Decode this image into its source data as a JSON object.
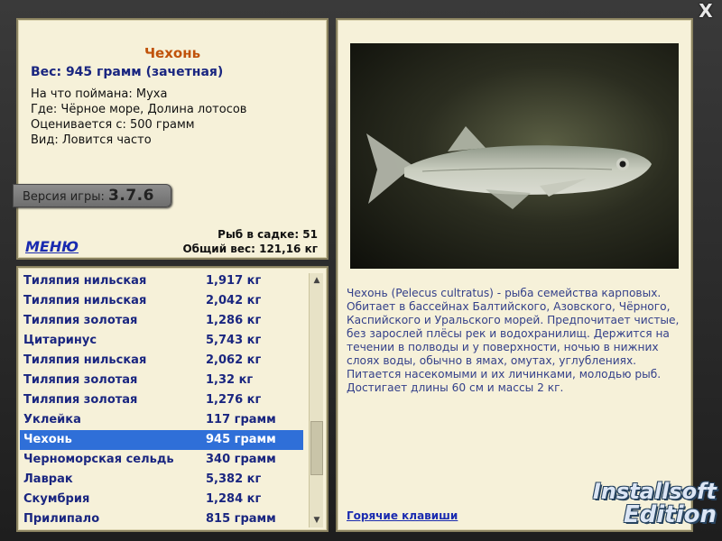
{
  "window": {
    "close_label": "X"
  },
  "info": {
    "name": "Чехонь",
    "weight": "Вес: 945 грамм (зачетная)",
    "caught_on": "На что поймана: Муха",
    "where": "Где: Чёрное море, Долина лотосов",
    "rated_from": "Оценивается с: 500 грамм",
    "kind": "Вид: Ловится часто",
    "version_label": "Версия игры:",
    "version_value": "3.7.6",
    "fish_count": "Рыб в садке: 51",
    "total_weight": "Общий вес: 121,16 кг",
    "menu_label": "МЕНЮ"
  },
  "right": {
    "description": "Чехонь (Pelecus cultratus) - рыба семейства карповых. Обитает в бассейнах Балтийского, Азовского, Чёрного, Каспийского и Уральского морей. Предпочитает чистые, без зарослей плёсы рек и водохранилищ. Держится на течении в полводы и у поверхности, ночью в нижних слоях воды, обычно в ямах, омутах, углублениях. Питается насекомыми и их личинками, молодью рыб. Достигает длины 60 см и массы 2 кг.",
    "hotkeys_label": "Горячие клавиши"
  },
  "catch_list": [
    {
      "name": "Тиляпия нильская",
      "weight": "1,917 кг"
    },
    {
      "name": "Тиляпия нильская",
      "weight": "2,042 кг"
    },
    {
      "name": "Тиляпия золотая",
      "weight": "1,286 кг"
    },
    {
      "name": "Цитаринус",
      "weight": "5,743 кг"
    },
    {
      "name": "Тиляпия нильская",
      "weight": "2,062 кг"
    },
    {
      "name": "Тиляпия золотая",
      "weight": "1,32 кг"
    },
    {
      "name": "Тиляпия золотая",
      "weight": "1,276 кг"
    },
    {
      "name": "Уклейка",
      "weight": "117 грамм"
    },
    {
      "name": "Чехонь",
      "weight": "945 грамм",
      "selected": true
    },
    {
      "name": "Черноморская сельдь",
      "weight": "340 грамм"
    },
    {
      "name": "Лаврак",
      "weight": "5,382 кг"
    },
    {
      "name": "Скумбрия",
      "weight": "1,284 кг"
    },
    {
      "name": "Прилипало",
      "weight": "815 грамм"
    }
  ],
  "logo": {
    "line1": "Installsoft",
    "line2": "Edition"
  },
  "colors": {
    "title": "#c0520a",
    "link": "#1a2bb0",
    "selected_row": "#2f6fd8"
  }
}
